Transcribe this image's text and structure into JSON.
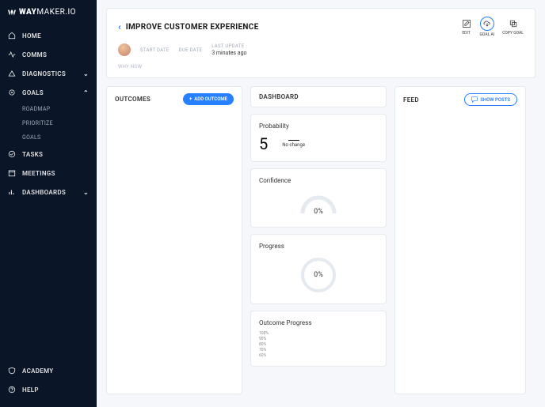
{
  "logo": {
    "brand1": "WAY",
    "brand2": "MAKER.IO"
  },
  "sidebar": {
    "items": [
      {
        "label": "HOME"
      },
      {
        "label": "COMMS"
      },
      {
        "label": "DIAGNOSTICS",
        "chev": "⌄"
      },
      {
        "label": "GOALS",
        "chev": "⌃"
      },
      {
        "label": "TASKS"
      },
      {
        "label": "MEETINGS"
      },
      {
        "label": "DASHBOARDS",
        "chev": "⌄"
      }
    ],
    "subitems": [
      {
        "label": "ROADMAP"
      },
      {
        "label": "PRIORITIZE"
      },
      {
        "label": "GOALS"
      }
    ],
    "bottom": [
      {
        "label": "ACADEMY"
      },
      {
        "label": "HELP"
      }
    ]
  },
  "header": {
    "title": "IMPROVE CUSTOMER EXPERIENCE",
    "actions": {
      "edit": "EDIT",
      "goalai": "GOAL AI",
      "copy": "COPY GOAL"
    },
    "meta": {
      "start": "START DATE",
      "due": "DUE DATE",
      "last": "LAST UPDATE",
      "lastValue": "3 minutes ago"
    },
    "whyNow": "WHY NOW"
  },
  "outcomes": {
    "title": "OUTCOMES",
    "addLabel": "ADD OUTCOME"
  },
  "dashboard": {
    "title": "DASHBOARD",
    "probability": {
      "label": "Probability",
      "value": "5",
      "noChange": "No change"
    },
    "confidence": {
      "label": "Confidence",
      "value": "0%"
    },
    "progress": {
      "label": "Progress",
      "value": "0%"
    },
    "outcomeProgress": {
      "label": "Outcome Progress",
      "ticks": [
        "100%",
        "90%",
        "80%",
        "70%",
        "60%"
      ]
    }
  },
  "feed": {
    "title": "FEED",
    "showPosts": "SHOW POSTS"
  }
}
